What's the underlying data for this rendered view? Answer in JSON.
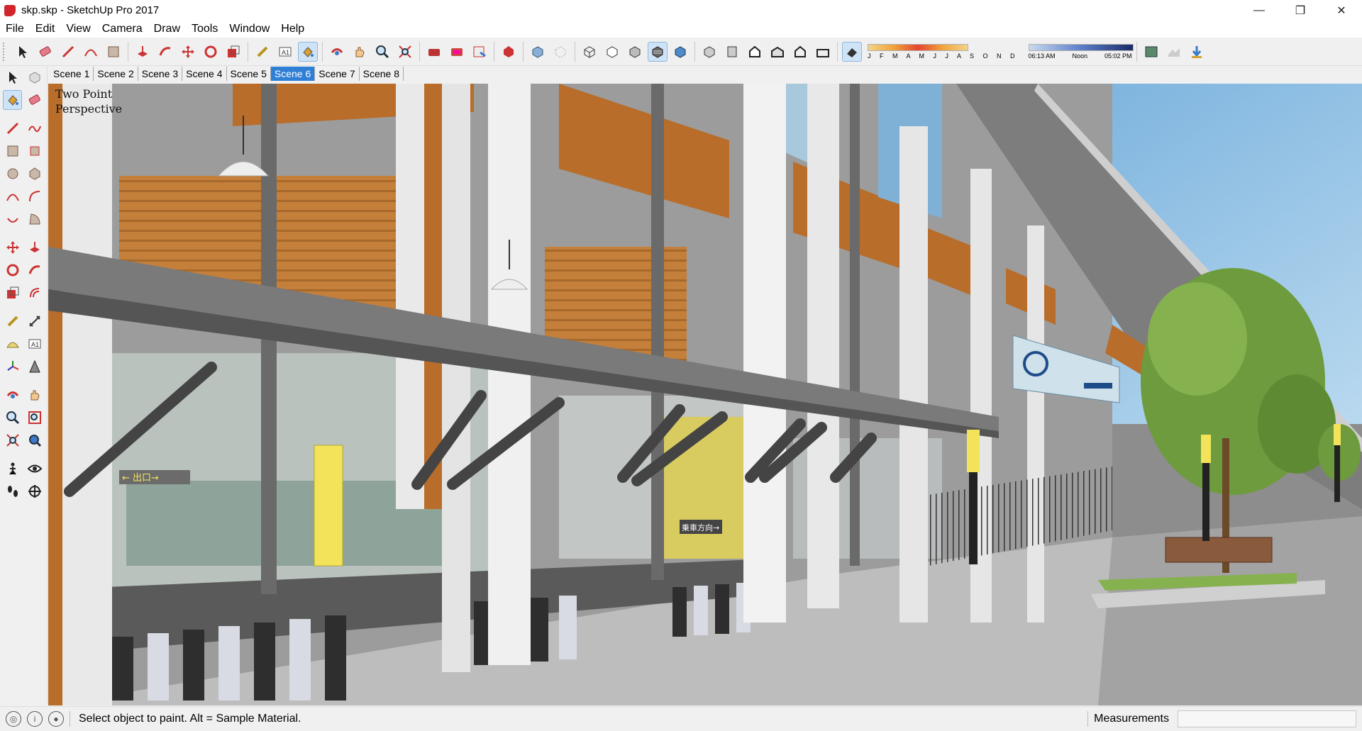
{
  "window": {
    "title": "skp.skp - SketchUp Pro 2017",
    "controls": [
      "—",
      "❐",
      "✕"
    ]
  },
  "menu": [
    "File",
    "Edit",
    "View",
    "Camera",
    "Draw",
    "Tools",
    "Window",
    "Help"
  ],
  "shadow_settings": {
    "months": "J F M A M J J A S O N D",
    "time_start": "06:13 AM",
    "time_mid": "Noon",
    "time_end": "05:02 PM"
  },
  "scenes": [
    "Scene 1",
    "Scene 2",
    "Scene 3",
    "Scene 4",
    "Scene 5",
    "Scene 6",
    "Scene 7",
    "Scene 8"
  ],
  "active_scene": "Scene 6",
  "viewport": {
    "label": "Two Point\nPerspective",
    "sign_exit": "←  出口→",
    "sign_direction": "乗車方向→"
  },
  "status": {
    "text": "Select object to paint. Alt = Sample Material.",
    "measurements_label": "Measurements",
    "measurements_value": ""
  },
  "colors": {
    "accent": "#2f7fd6",
    "wood": "#b86d2a",
    "concrete": "#9a9a9a",
    "sky": "#7fb6de",
    "tree": "#6e9b3d",
    "bollard": "#f2e35a"
  }
}
